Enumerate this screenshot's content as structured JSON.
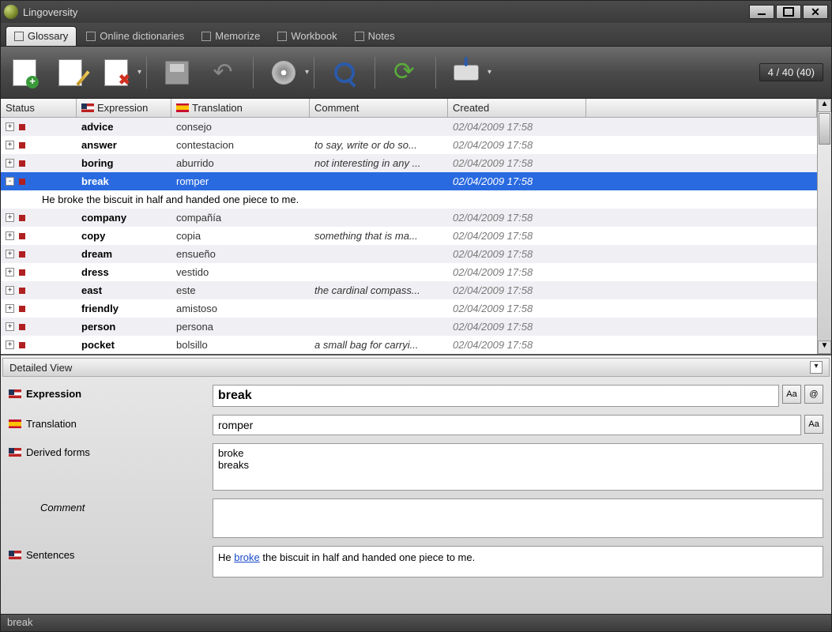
{
  "app": {
    "title": "Lingoversity"
  },
  "tabs": [
    {
      "label": "Glossary",
      "active": true
    },
    {
      "label": "Online dictionaries",
      "active": false
    },
    {
      "label": "Memorize",
      "active": false
    },
    {
      "label": "Workbook",
      "active": false
    },
    {
      "label": "Notes",
      "active": false
    }
  ],
  "toolbar": {
    "counter": "4 / 40 (40)"
  },
  "columns": {
    "status": "Status",
    "expression": "Expression",
    "translation": "Translation",
    "comment": "Comment",
    "created": "Created"
  },
  "rows": [
    {
      "expander": "+",
      "expression": "advice",
      "translation": "consejo",
      "comment": "",
      "created": "02/04/2009 17:58",
      "shade": "even"
    },
    {
      "expander": "+",
      "expression": "answer",
      "translation": "contestacion",
      "comment": "to say, write or do so...",
      "created": "02/04/2009 17:58",
      "shade": "odd"
    },
    {
      "expander": "+",
      "expression": "boring",
      "translation": "aburrido",
      "comment": "not interesting in any ...",
      "created": "02/04/2009 17:58",
      "shade": "even"
    },
    {
      "expander": "-",
      "expression": "break",
      "translation": "romper",
      "comment": "",
      "created": "02/04/2009 17:58",
      "shade": "sel",
      "selected": true
    },
    {
      "detail": "He broke the biscuit in half and handed one piece to me."
    },
    {
      "expander": "+",
      "expression": "company",
      "translation": "compañía",
      "comment": "",
      "created": "02/04/2009 17:58",
      "shade": "even"
    },
    {
      "expander": "+",
      "expression": "copy",
      "translation": "copia",
      "comment": "something that is ma...",
      "created": "02/04/2009 17:58",
      "shade": "odd"
    },
    {
      "expander": "+",
      "expression": "dream",
      "translation": "ensueño",
      "comment": "",
      "created": "02/04/2009 17:58",
      "shade": "even"
    },
    {
      "expander": "+",
      "expression": "dress",
      "translation": "vestido",
      "comment": "",
      "created": "02/04/2009 17:58",
      "shade": "odd"
    },
    {
      "expander": "+",
      "expression": "east",
      "translation": "este",
      "comment": "the cardinal compass...",
      "created": "02/04/2009 17:58",
      "shade": "even"
    },
    {
      "expander": "+",
      "expression": "friendly",
      "translation": "amistoso",
      "comment": "",
      "created": "02/04/2009 17:58",
      "shade": "odd"
    },
    {
      "expander": "+",
      "expression": "person",
      "translation": "persona",
      "comment": "",
      "created": "02/04/2009 17:58",
      "shade": "even"
    },
    {
      "expander": "+",
      "expression": "pocket",
      "translation": "bolsillo",
      "comment": "a small bag for carryi...",
      "created": "02/04/2009 17:58",
      "shade": "odd"
    }
  ],
  "detail": {
    "title": "Detailed View",
    "labels": {
      "expression": "Expression",
      "translation": "Translation",
      "derived": "Derived forms",
      "comment": "Comment",
      "sentences": "Sentences"
    },
    "expression": "break",
    "translation": "romper",
    "derived": "broke\nbreaks",
    "comment": "",
    "sentence_pre": "He ",
    "sentence_hl": "broke",
    "sentence_post": " the biscuit in half and handed one piece to me.",
    "btn_aa": "Aa",
    "btn_web": "@"
  },
  "statusbar": "break"
}
